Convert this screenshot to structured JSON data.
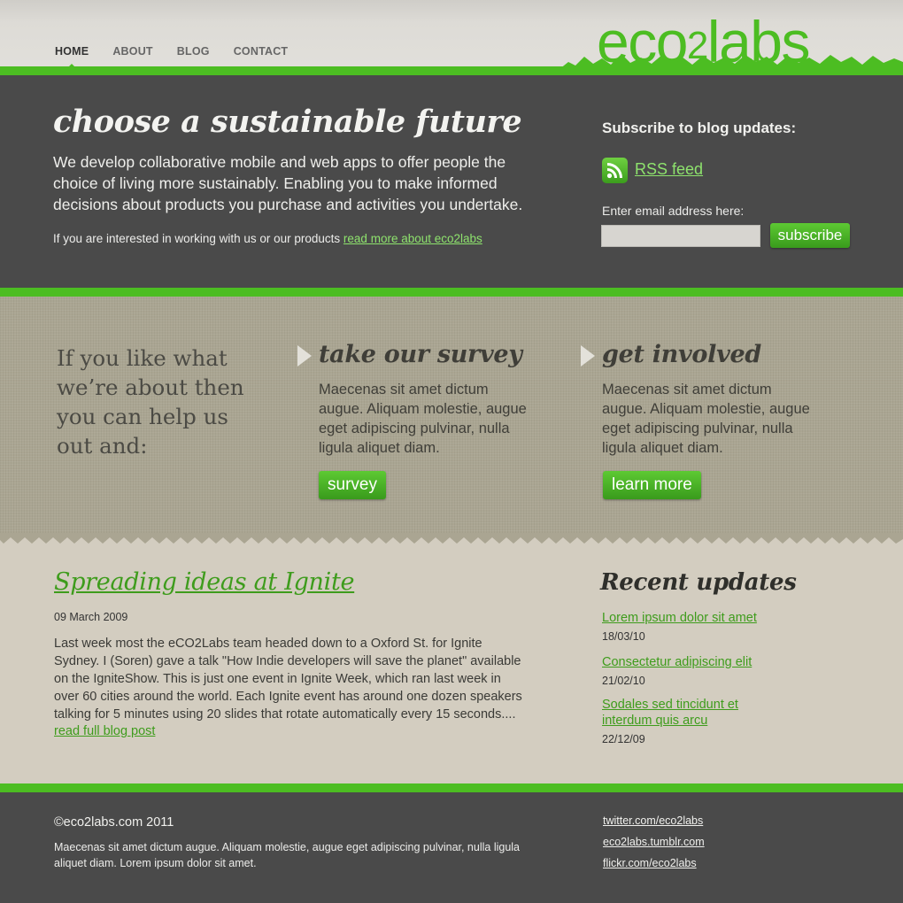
{
  "colors": {
    "brand_green": "#4cbd22",
    "dark": "#4a4a4a",
    "link_light": "#8ee36d",
    "link_dark": "#3e9c1c"
  },
  "nav": {
    "items": [
      {
        "label": "HOME",
        "active": true
      },
      {
        "label": "ABOUT"
      },
      {
        "label": "BLOG"
      },
      {
        "label": "CONTACT"
      }
    ]
  },
  "logo": {
    "part1": "eco",
    "part2": "2",
    "part3": "labs"
  },
  "hero": {
    "title": "choose a sustainable future",
    "description": "We develop collaborative mobile and web apps to offer people the choice of living more sustainably. Enabling you to make informed decisions about products you purchase and activities you undertake.",
    "note": "If you are interested in working with us or our products ",
    "note_link": "read more about eco2labs"
  },
  "subscribe": {
    "title": "Subscribe to blog updates:",
    "rss_icon": "rss-icon",
    "rss_label": "RSS feed",
    "email_label": "Enter email address here:",
    "email_value": "",
    "button": "subscribe"
  },
  "cta": {
    "intro": "If you like what we’re about then you can help us out and:",
    "items": [
      {
        "title": "take our survey",
        "text": "Maecenas sit amet dictum augue. Aliquam molestie, augue eget adipiscing pulvinar, nulla ligula aliquet diam.",
        "button": "survey"
      },
      {
        "title": "get involved",
        "text": "Maecenas sit amet dictum augue. Aliquam molestie, augue eget adipiscing pulvinar, nulla ligula aliquet diam.",
        "button": "learn more"
      }
    ]
  },
  "post": {
    "title": "Spreading ideas at Ignite",
    "date": "09 March 2009",
    "body": "Last week most the eCO2Labs team headed down to a Oxford St. for Ignite Sydney. I (Soren) gave a talk  \"How Indie developers will save the planet\" available on the IgniteShow. This is just one event in Ignite Week, which ran last week in over 60 cities around the world. Each Ignite event has around one dozen speakers talking for 5 minutes using 20 slides that rotate automatically every 15 seconds....",
    "read_more": "read full blog post"
  },
  "recent": {
    "title": "Recent updates",
    "items": [
      {
        "label": "Lorem ipsum dolor sit amet",
        "date": "18/03/10"
      },
      {
        "label": "Consectetur adipiscing elit",
        "date": "21/02/10"
      },
      {
        "label": "Sodales sed tincidunt et interdum quis arcu",
        "date": "22/12/09"
      }
    ]
  },
  "footer": {
    "copyright": "©eco2labs.com 2011",
    "text": "Maecenas sit amet dictum augue. Aliquam molestie, augue eget adipiscing pulvinar, nulla ligula aliquet diam. Lorem ipsum dolor sit amet.",
    "links": [
      "twitter.com/eco2labs",
      "eco2labs.tumblr.com",
      "flickr.com/eco2labs"
    ]
  }
}
